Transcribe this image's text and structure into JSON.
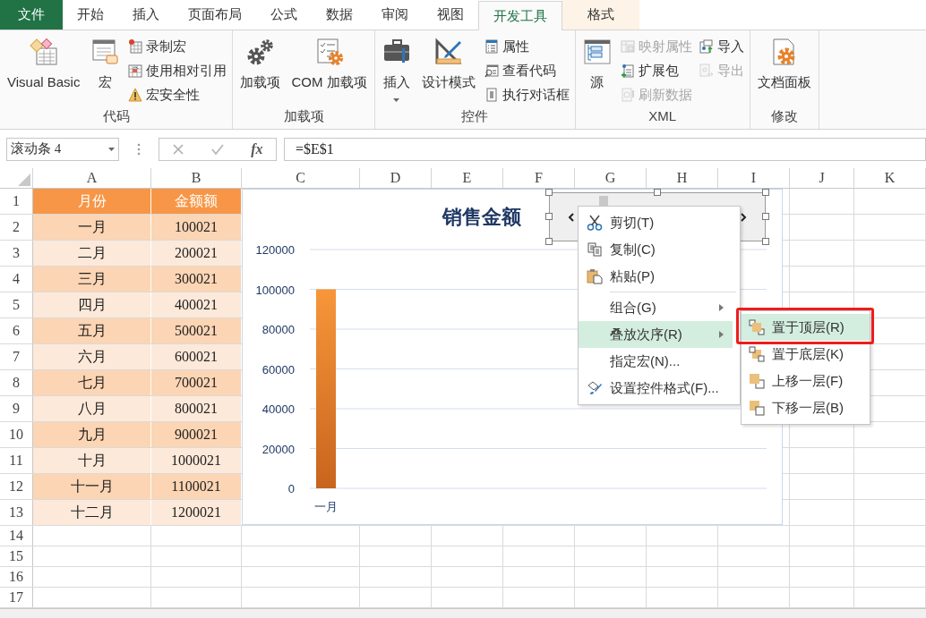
{
  "ribbon_tabs": [
    {
      "label": "文件",
      "kind": "file",
      "selected": false
    },
    {
      "label": "开始",
      "kind": "normal",
      "selected": false
    },
    {
      "label": "插入",
      "kind": "normal",
      "selected": false
    },
    {
      "label": "页面布局",
      "kind": "normal",
      "selected": false
    },
    {
      "label": "公式",
      "kind": "normal",
      "selected": false
    },
    {
      "label": "数据",
      "kind": "normal",
      "selected": false
    },
    {
      "label": "审阅",
      "kind": "normal",
      "selected": false
    },
    {
      "label": "视图",
      "kind": "normal",
      "selected": false
    },
    {
      "label": "开发工具",
      "kind": "normal",
      "selected": true
    },
    {
      "label": "格式",
      "kind": "contextual",
      "selected": false
    }
  ],
  "ribbon_groups": [
    {
      "label": "代码",
      "items": [
        {
          "kind": "large",
          "label": "Visual Basic",
          "dropdown": false,
          "disabled": false
        },
        {
          "kind": "large",
          "label": "宏",
          "dropdown": false,
          "disabled": false
        },
        {
          "kind": "stack",
          "items": [
            {
              "label": "录制宏",
              "disabled": false
            },
            {
              "label": "使用相对引用",
              "disabled": false
            },
            {
              "label": "宏安全性",
              "disabled": false
            }
          ]
        }
      ]
    },
    {
      "label": "加载项",
      "items": [
        {
          "kind": "large",
          "label": "加载项",
          "dropdown": false,
          "disabled": false
        },
        {
          "kind": "large",
          "label": "COM 加载项",
          "dropdown": false,
          "disabled": false
        }
      ]
    },
    {
      "label": "控件",
      "items": [
        {
          "kind": "large",
          "label": "插入",
          "dropdown": true,
          "disabled": false
        },
        {
          "kind": "large",
          "label": "设计模式",
          "dropdown": false,
          "disabled": false
        },
        {
          "kind": "stack",
          "items": [
            {
              "label": "属性",
              "disabled": false
            },
            {
              "label": "查看代码",
              "disabled": false
            },
            {
              "label": "执行对话框",
              "disabled": false
            }
          ]
        }
      ]
    },
    {
      "label": "XML",
      "items": [
        {
          "kind": "large",
          "label": "源",
          "dropdown": false,
          "disabled": false
        },
        {
          "kind": "stack",
          "items": [
            {
              "label": "映射属性",
              "disabled": true
            },
            {
              "label": "扩展包",
              "disabled": false
            },
            {
              "label": "刷新数据",
              "disabled": true
            }
          ]
        },
        {
          "kind": "stack",
          "items": [
            {
              "label": "导入",
              "disabled": false
            },
            {
              "label": "导出",
              "disabled": true
            }
          ]
        }
      ]
    },
    {
      "label": "修改",
      "items": [
        {
          "kind": "large",
          "label": "文档面板",
          "dropdown": false,
          "disabled": false
        }
      ]
    }
  ],
  "formula_bar": {
    "name_box": "滚动条 4",
    "function_label": "fx",
    "formula": "=$E$1"
  },
  "sheet": {
    "columns": [
      "A",
      "B",
      "C",
      "D",
      "E",
      "F",
      "G",
      "H",
      "I",
      "J",
      "K"
    ],
    "row_numbers": [
      "1",
      "2",
      "3",
      "4",
      "5",
      "6",
      "7",
      "8",
      "9",
      "10",
      "11",
      "12",
      "13",
      "14",
      "15",
      "16",
      "17"
    ],
    "rows": [
      {
        "cells": [
          "月份",
          "金额额"
        ]
      },
      {
        "cells": [
          "一月",
          "100021"
        ]
      },
      {
        "cells": [
          "二月",
          "200021"
        ]
      },
      {
        "cells": [
          "三月",
          "300021"
        ]
      },
      {
        "cells": [
          "四月",
          "400021"
        ]
      },
      {
        "cells": [
          "五月",
          "500021"
        ]
      },
      {
        "cells": [
          "六月",
          "600021"
        ]
      },
      {
        "cells": [
          "七月",
          "700021"
        ]
      },
      {
        "cells": [
          "八月",
          "800021"
        ]
      },
      {
        "cells": [
          "九月",
          "900021"
        ]
      },
      {
        "cells": [
          "十月",
          "1000021"
        ]
      },
      {
        "cells": [
          "十一月",
          "1100021"
        ]
      },
      {
        "cells": [
          "十二月",
          "1200021"
        ]
      }
    ]
  },
  "chart": {
    "chart_data": {
      "type": "bar",
      "title": "销售金额",
      "categories": [
        "一月"
      ],
      "values": [
        100000
      ],
      "grid": true,
      "ylim": [
        0,
        120000
      ],
      "yticks": [
        0,
        20000,
        40000,
        60000,
        80000,
        100000,
        120000
      ]
    }
  },
  "context_menu": {
    "items": [
      {
        "kind": "command",
        "label": "剪切(T)",
        "submenu": false,
        "selected": false
      },
      {
        "kind": "command",
        "label": "复制(C)",
        "submenu": false,
        "selected": false
      },
      {
        "kind": "command",
        "label": "粘贴(P)",
        "submenu": false,
        "selected": false
      },
      {
        "kind": "separator"
      },
      {
        "kind": "command",
        "label": "组合(G)",
        "submenu": true,
        "selected": false
      },
      {
        "kind": "command",
        "label": "叠放次序(R)",
        "submenu": true,
        "selected": true
      },
      {
        "kind": "command",
        "label": "指定宏(N)...",
        "submenu": false,
        "selected": false
      },
      {
        "kind": "command",
        "label": "设置控件格式(F)...",
        "submenu": false,
        "selected": false
      }
    ]
  },
  "submenu": {
    "items": [
      {
        "label": "置于顶层(R)",
        "selected": true,
        "outlined": true
      },
      {
        "label": "置于底层(K)",
        "selected": false,
        "outlined": false
      },
      {
        "label": "上移一层(F)",
        "selected": false,
        "outlined": false
      },
      {
        "label": "下移一层(B)",
        "selected": false,
        "outlined": false
      }
    ]
  }
}
